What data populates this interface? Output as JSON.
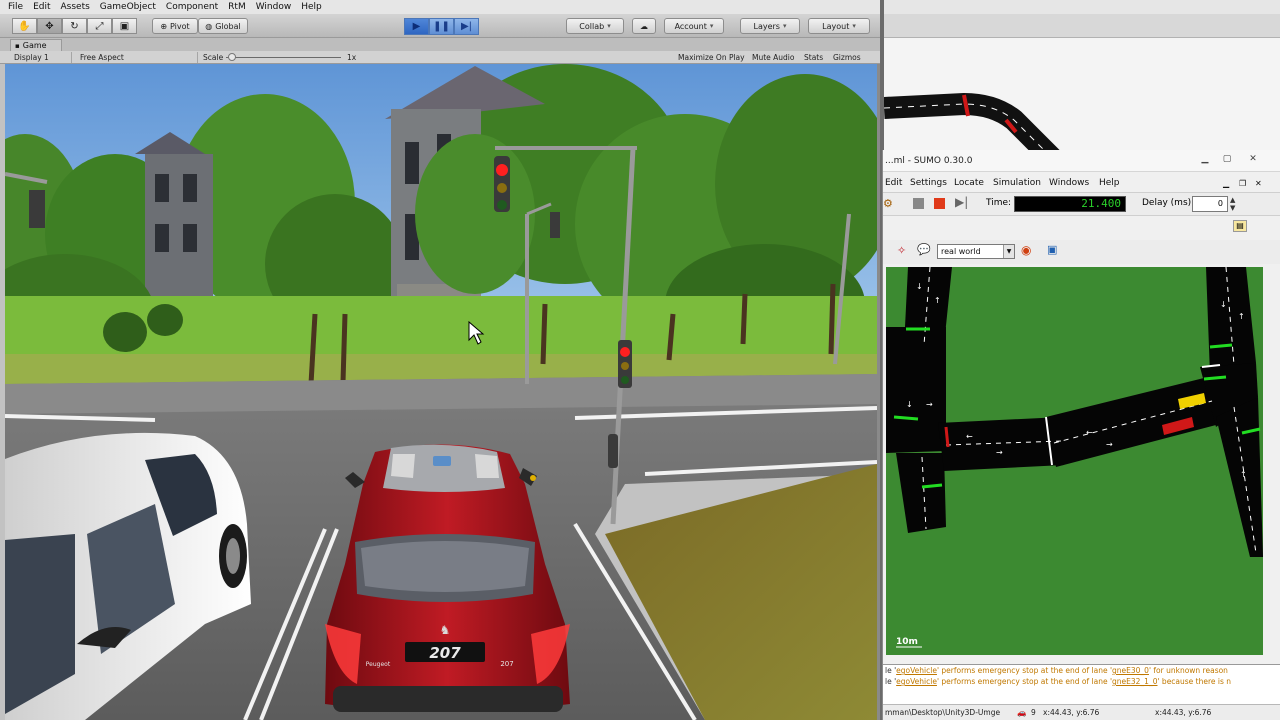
{
  "unity": {
    "menu": [
      "File",
      "Edit",
      "Assets",
      "GameObject",
      "Component",
      "RtM",
      "Window",
      "Help"
    ],
    "toolbar": {
      "tools": [
        "hand-icon",
        "move-icon",
        "rotate-icon",
        "scale-icon",
        "rect-icon"
      ],
      "pivot": "Pivot",
      "global": "Global",
      "collab": "Collab",
      "account": "Account",
      "layers": "Layers",
      "layout": "Layout"
    },
    "game_tab": "Game",
    "game_bar": {
      "display": "Display 1",
      "aspect": "Free Aspect",
      "scale_label": "Scale",
      "scale_value": "1x",
      "maximize": "Maximize On Play",
      "mute": "Mute Audio",
      "stats": "Stats",
      "gizmos": "Gizmos"
    },
    "scene": {
      "plate_text": "207",
      "plate_small": "207",
      "badge_text": "Peugeot"
    }
  },
  "sumo": {
    "title": "...ml - SUMO 0.30.0",
    "menu": [
      "Edit",
      "Settings",
      "Locate",
      "Simulation",
      "Windows",
      "Help"
    ],
    "time_label": "Time:",
    "time_value": "21.400",
    "delay_label": "Delay (ms):",
    "delay_value": "0",
    "view_option": "real world",
    "scale_label": "10m",
    "messages": [
      {
        "pre": "le '",
        "veh": "egoVehicle",
        "mid": "' performs emergency stop at the end of lane '",
        "lane": "gneE30_0",
        "post": "' for unknown reason"
      },
      {
        "pre": "le '",
        "veh": "egoVehicle",
        "mid": "' performs emergency stop at the end of lane '",
        "lane": "gneE32_1_0",
        "post": "' because there is n"
      }
    ],
    "status": {
      "path": "mman\\Desktop\\Unity3D-Umge",
      "count": "9",
      "coords1": "x:44.43, y:6.76",
      "coords2": "x:44.43, y:6.76"
    }
  },
  "colors": {
    "grass_sumo": "#3c8a31",
    "road_sumo": "#0a0a0a",
    "car_red": "#a8141e",
    "time_green": "#2ad02a"
  }
}
